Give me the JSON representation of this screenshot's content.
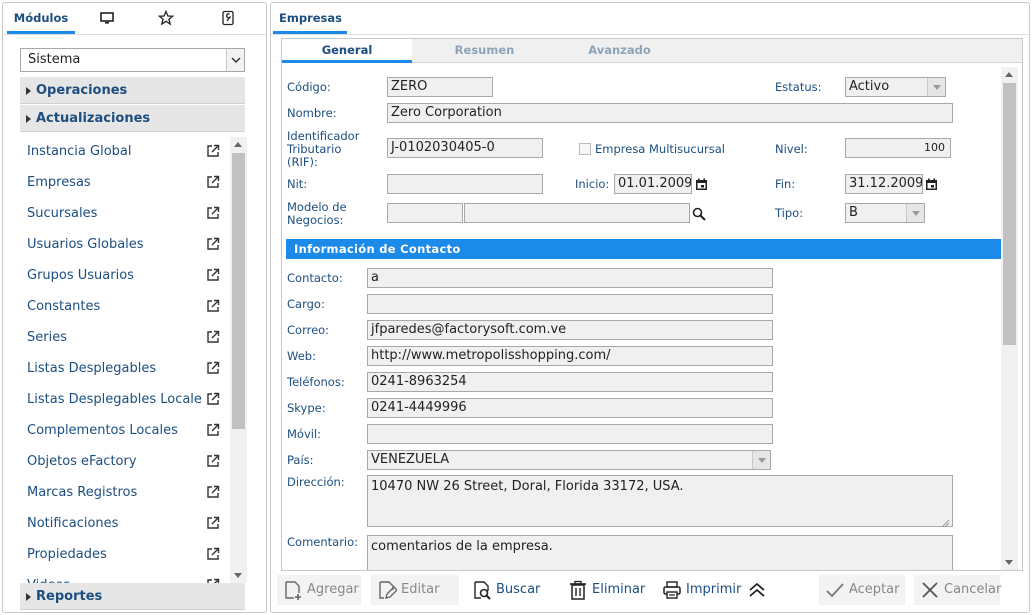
{
  "left_panel": {
    "tabs": [
      {
        "label": "Módulos",
        "icon": "modules-tab"
      },
      {
        "icon": "monitor-icon"
      },
      {
        "icon": "star-icon"
      },
      {
        "icon": "wrench-icon"
      }
    ],
    "module_select": {
      "value": "Sistema"
    },
    "groups": {
      "operaciones": "Operaciones",
      "actualizaciones": "Actualizaciones",
      "reportes": "Reportes"
    },
    "items": [
      "Instancia Global",
      "Empresas",
      "Sucursales",
      "Usuarios Globales",
      "Grupos Usuarios",
      "Constantes",
      "Series",
      "Listas Desplegables",
      "Listas Desplegables Locale",
      "Complementos Locales",
      "Objetos eFactory",
      "Marcas Registros",
      "Notificaciones",
      "Propiedades",
      "Videos"
    ]
  },
  "right_panel": {
    "title": "Empresas",
    "tabs": [
      "General",
      "Resumen",
      "Avanzado"
    ],
    "active_tab": "General",
    "form": {
      "codigo_label": "Código:",
      "codigo_value": "ZERO",
      "estatus_label": "Estatus:",
      "estatus_value": "Activo",
      "nombre_label": "Nombre:",
      "nombre_value": "Zero Corporation",
      "rif_label_1": "Identificador",
      "rif_label_2": "Tributario",
      "rif_label_3": "(RIF):",
      "rif_value": "J-0102030405-0",
      "multisucursal_label": "Empresa Multisucursal",
      "nivel_label": "Nivel:",
      "nivel_value": "100",
      "nit_label": "Nit:",
      "nit_value": "",
      "inicio_label": "Inicio:",
      "inicio_value": "01.01.2009",
      "fin_label": "Fin:",
      "fin_value": "31.12.2009",
      "modelo_label_1": "Modelo de",
      "modelo_label_2": "Negocios:",
      "modelo_code": "",
      "modelo_desc": "",
      "tipo_label": "Tipo:",
      "tipo_value": "B"
    },
    "contact": {
      "header": "Información de Contacto",
      "contacto_label": "Contacto:",
      "contacto_value": "a",
      "cargo_label": "Cargo:",
      "cargo_value": "",
      "correo_label": "Correo:",
      "correo_value": "jfparedes@factorysoft.com.ve",
      "web_label": "Web:",
      "web_value": "http://www.metropolisshopping.com/",
      "telefonos_label": "Teléfonos:",
      "telefonos_value": "0241-8963254",
      "skype_label": "Skype:",
      "skype_value": "0241-4449996",
      "movil_label": "Móvil:",
      "movil_value": "",
      "pais_label": "País:",
      "pais_value": "VENEZUELA",
      "direccion_label": "Dirección:",
      "direccion_value": "10470 NW 26 Street, Doral, Florida 33172, USA.",
      "comentario_label": "Comentario:",
      "comentario_value": "comentarios de la empresa."
    },
    "toolbar": {
      "agregar": "Agregar",
      "editar": "Editar",
      "buscar": "Buscar",
      "eliminar": "Eliminar",
      "imprimir": "Imprimir",
      "aceptar": "Aceptar",
      "cancelar": "Cancelar"
    }
  },
  "colors": {
    "accent": "#1c8ae8",
    "link_text": "#1c4e80",
    "field_bg": "#f0f0f0",
    "group_bg": "#e6e6e6"
  }
}
